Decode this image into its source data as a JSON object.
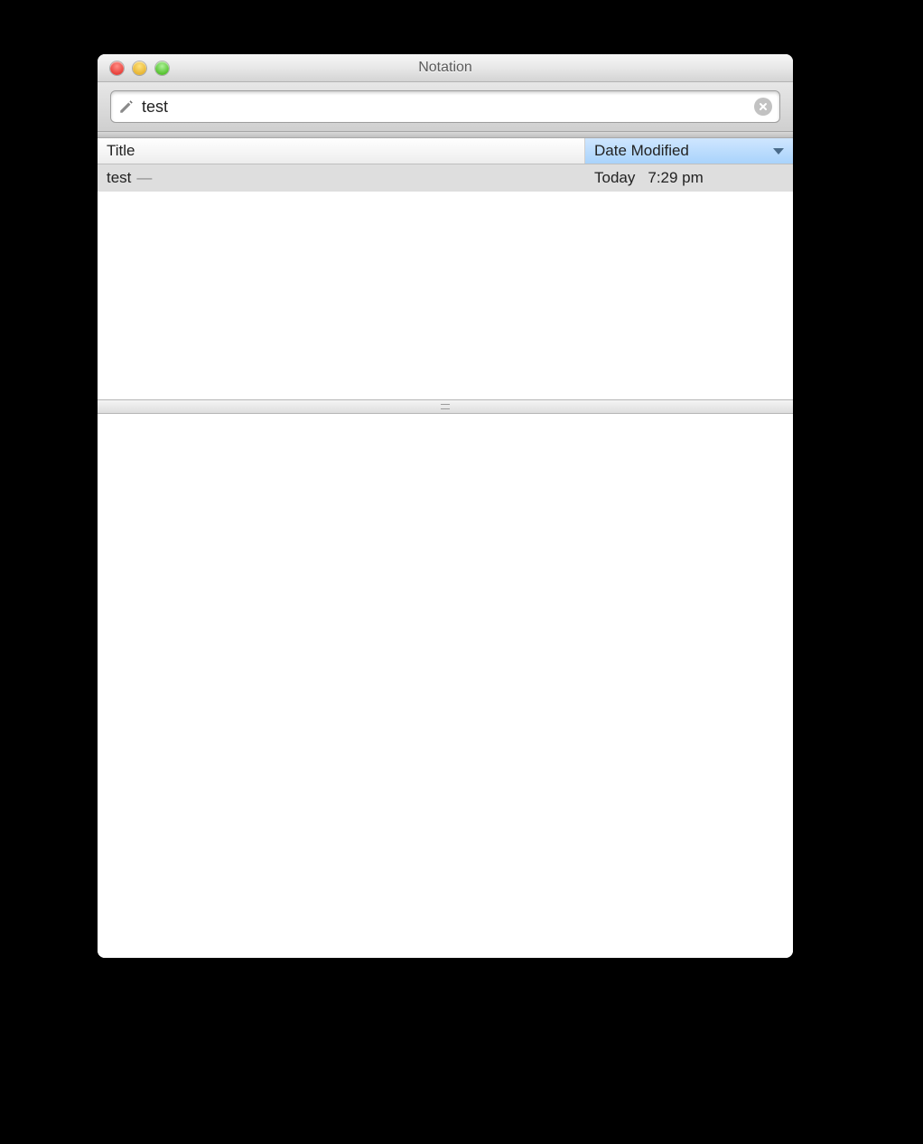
{
  "window": {
    "title": "Notation"
  },
  "search": {
    "value": "test"
  },
  "columns": {
    "title": "Title",
    "date": "Date Modified"
  },
  "rows": [
    {
      "title": "test",
      "preview": "—",
      "date_day": "Today",
      "date_time": "7:29 pm"
    }
  ],
  "editor": {
    "content": ""
  }
}
